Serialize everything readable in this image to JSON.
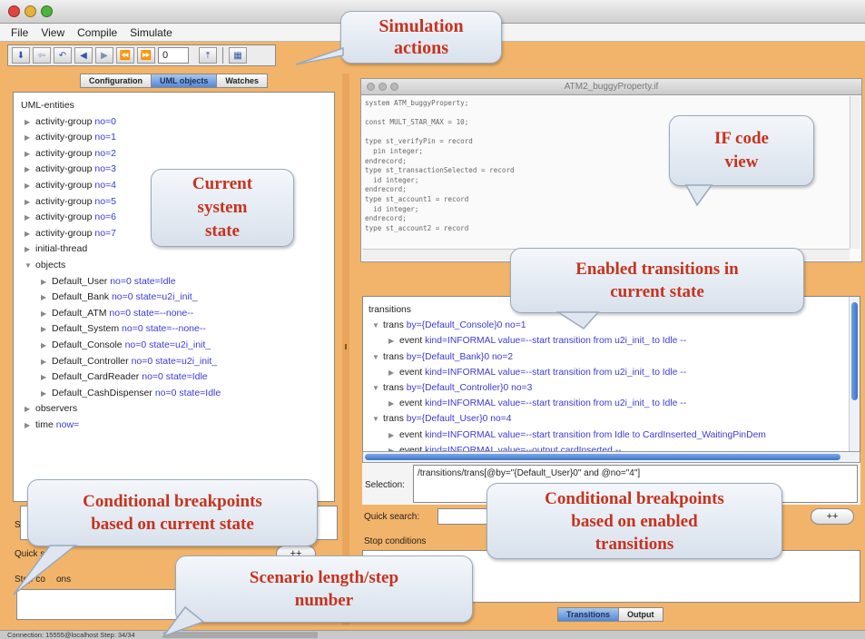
{
  "menu": [
    "File",
    "View",
    "Compile",
    "Simulate"
  ],
  "toolbar": {
    "step_value": "0",
    "icons": [
      "step-down-icon",
      "back-icon",
      "step-back-icon",
      "rewind-step-icon",
      "play-step-icon",
      "fast-back-icon",
      "fast-forward-icon",
      "jump-icon",
      "inspect-icon"
    ]
  },
  "left_tabs": [
    {
      "label": "Configuration",
      "selected": false
    },
    {
      "label": "UML objects",
      "selected": true
    },
    {
      "label": "Watches",
      "selected": false
    }
  ],
  "uml_tree": [
    {
      "level": 0,
      "name": "UML-entities",
      "detail": "",
      "arrow": ""
    },
    {
      "level": 1,
      "name": "activity-group",
      "detail": "no=0",
      "arrow": "right"
    },
    {
      "level": 1,
      "name": "activity-group",
      "detail": "no=1",
      "arrow": "right"
    },
    {
      "level": 1,
      "name": "activity-group",
      "detail": "no=2",
      "arrow": "right"
    },
    {
      "level": 1,
      "name": "activity-group",
      "detail": "no=3",
      "arrow": "right"
    },
    {
      "level": 1,
      "name": "activity-group",
      "detail": "no=4",
      "arrow": "right"
    },
    {
      "level": 1,
      "name": "activity-group",
      "detail": "no=5",
      "arrow": "right"
    },
    {
      "level": 1,
      "name": "activity-group",
      "detail": "no=6",
      "arrow": "right"
    },
    {
      "level": 1,
      "name": "activity-group",
      "detail": "no=7",
      "arrow": "right"
    },
    {
      "level": 1,
      "name": "initial-thread",
      "detail": "",
      "arrow": "right"
    },
    {
      "level": 1,
      "name": "objects",
      "detail": "",
      "arrow": "down"
    },
    {
      "level": 2,
      "name": "Default_User",
      "detail": "no=0 state=Idle",
      "arrow": "right"
    },
    {
      "level": 2,
      "name": "Default_Bank",
      "detail": "no=0 state=u2i_init_",
      "arrow": "right"
    },
    {
      "level": 2,
      "name": "Default_ATM",
      "detail": "no=0 state=--none--",
      "arrow": "right"
    },
    {
      "level": 2,
      "name": "Default_System",
      "detail": "no=0 state=--none--",
      "arrow": "right"
    },
    {
      "level": 2,
      "name": "Default_Console",
      "detail": "no=0 state=u2i_init_",
      "arrow": "right"
    },
    {
      "level": 2,
      "name": "Default_Controller",
      "detail": "no=0 state=u2i_init_",
      "arrow": "right"
    },
    {
      "level": 2,
      "name": "Default_CardReader",
      "detail": "no=0 state=Idle",
      "arrow": "right"
    },
    {
      "level": 2,
      "name": "Default_CashDispenser",
      "detail": "no=0 state=Idle",
      "arrow": "right"
    },
    {
      "level": 1,
      "name": "observers",
      "detail": "",
      "arrow": "right"
    },
    {
      "level": 1,
      "name": "time",
      "detail": "now=",
      "arrow": "right"
    }
  ],
  "left_bottom": {
    "selection_label": "S",
    "quick_search_label": "Quick sea",
    "stop_conditions_label": "Stop co",
    "stop_conditions_suffix": "ons",
    "plus_button": "++"
  },
  "if_window": {
    "title": "ATM2_buggyProperty.if",
    "code": "system ATM_buggyProperty;\n\nconst MULT_STAR_MAX = 10;\n\ntype st_verifyPin = record\n  pin integer;\nendrecord;\ntype st_transactionSelected = record\n  id integer;\nendrecord;\ntype st_account1 = record\n  id integer;\nendrecord;\ntype st_account2 = record"
  },
  "transitions": {
    "header": "transitions",
    "rows": [
      {
        "level": 1,
        "arrow": "down",
        "name": "trans",
        "detail": "by={Default_Console}0 no=1"
      },
      {
        "level": 2,
        "arrow": "right",
        "name": "event",
        "detail": "kind=INFORMAL value=--start transition from u2i_init_ to Idle --"
      },
      {
        "level": 1,
        "arrow": "down",
        "name": "trans",
        "detail": "by={Default_Bank}0 no=2"
      },
      {
        "level": 2,
        "arrow": "right",
        "name": "event",
        "detail": "kind=INFORMAL value=--start transition from u2i_init_ to Idle --"
      },
      {
        "level": 1,
        "arrow": "down",
        "name": "trans",
        "detail": "by={Default_Controller}0 no=3"
      },
      {
        "level": 2,
        "arrow": "right",
        "name": "event",
        "detail": "kind=INFORMAL value=--start transition from u2i_init_ to Idle --"
      },
      {
        "level": 1,
        "arrow": "down",
        "name": "trans",
        "detail": "by={Default_User}0 no=4"
      },
      {
        "level": 2,
        "arrow": "right",
        "name": "event",
        "detail": "kind=INFORMAL value=--start transition from Idle to CardInserted_WaitingPinDem"
      },
      {
        "level": 2,
        "arrow": "right",
        "name": "event",
        "detail": "kind=INFORMAL value=--output cardInserted --"
      }
    ]
  },
  "selection": {
    "label": "Selection:",
    "value": "/transitions/trans[@by=\"{Default_User}0\" and @no=\"4\"]"
  },
  "right_bottom": {
    "quick_search_label": "Quick search:",
    "stop_conditions_label": "Stop conditions",
    "plus_button": "++"
  },
  "right_tabs": [
    {
      "label": "Transitions",
      "selected": true
    },
    {
      "label": "Output",
      "selected": false
    }
  ],
  "status": {
    "text": "Connection: 15555@localhost Step: 34/34"
  },
  "callouts": {
    "simulation_actions": [
      "Simulation",
      "actions"
    ],
    "current_state": [
      "Current",
      "system",
      "state"
    ],
    "if_code": [
      "IF code",
      "view"
    ],
    "enabled_transitions": [
      "Enabled transitions in",
      "current state"
    ],
    "cond_bp_state": [
      "Conditional breakpoints",
      "based on current state"
    ],
    "cond_bp_trans": [
      "Conditional breakpoints",
      "based on enabled",
      "transitions"
    ],
    "scenario_length": [
      "Scenario length/step",
      "number"
    ]
  },
  "colors": {
    "background": "#f2b46a",
    "callout_text": "#c8321d",
    "value_blue": "#3a3ad8",
    "tab_selected": "#5588d6"
  }
}
